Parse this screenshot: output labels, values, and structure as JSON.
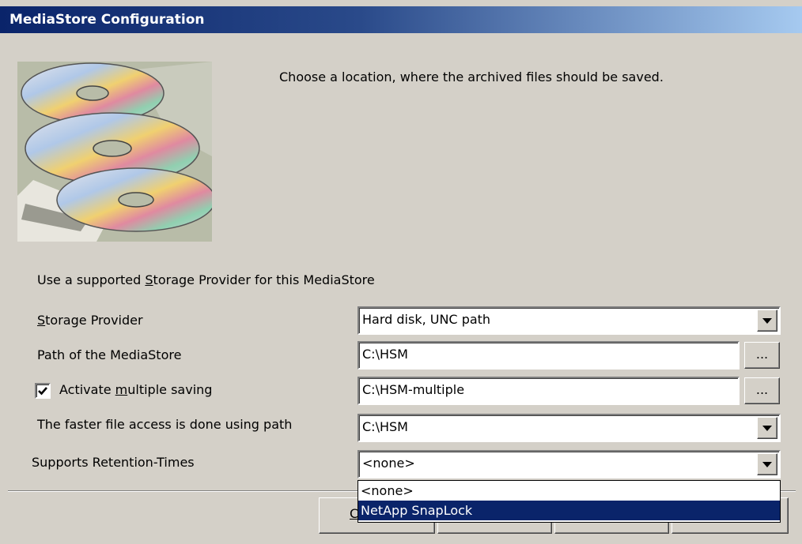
{
  "window": {
    "title": "MediaStore Configuration"
  },
  "intro_text": "Choose a location, where the archived files should be saved.",
  "section_label": {
    "before": "Use a supported ",
    "underline": "S",
    "after": "torage Provider for this MediaStore"
  },
  "storage_provider": {
    "label_underline": "S",
    "label_rest": "torage Provider",
    "value": "Hard disk, UNC path"
  },
  "mediastore_path": {
    "label": "Path of the MediaStore",
    "value": "C:\\HSM",
    "browse_label": "..."
  },
  "multiple_saving": {
    "checked": true,
    "label_before": "Activate ",
    "label_underline": "m",
    "label_after": "ultiple saving",
    "value": "C:\\HSM-multiple",
    "browse_label": "..."
  },
  "faster_access": {
    "label": "The faster file access is done using path",
    "value": "C:\\HSM"
  },
  "retention": {
    "label": "Supports Retention-Times",
    "value": "<none>",
    "options": [
      "<none>",
      "NetApp SnapLock"
    ],
    "highlighted_index": 1
  },
  "bottom_buttons": {
    "first_partial_label": "C"
  },
  "icons": {
    "picture": "cd-discs-image",
    "dropdown_arrow": "chevron-down-icon",
    "checkbox_mark": "checkmark-icon"
  },
  "colors": {
    "title_start": "#0a246a",
    "title_end": "#a6caf0",
    "face": "#d4d0c8",
    "highlight": "#0a246a"
  }
}
